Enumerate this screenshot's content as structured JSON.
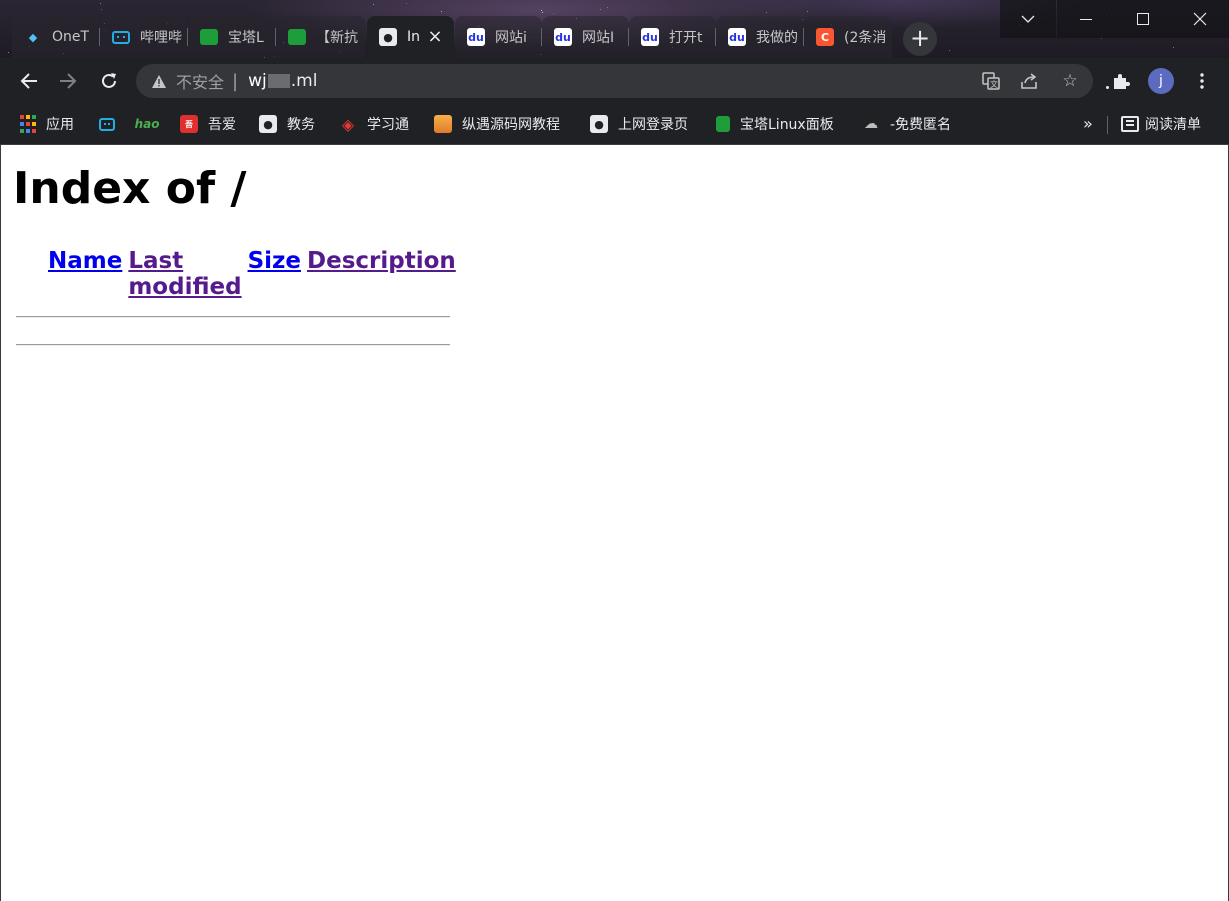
{
  "tabs": [
    {
      "title": "OneT",
      "favicon": "diamond-icon",
      "active": false
    },
    {
      "title": "哔哩哔",
      "favicon": "bilibili-icon",
      "active": false
    },
    {
      "title": "宝塔L",
      "favicon": "baota-icon",
      "active": false
    },
    {
      "title": "【新抗",
      "favicon": "baota-icon",
      "active": false
    },
    {
      "title": "In",
      "favicon": "globe-icon",
      "active": true
    },
    {
      "title": "网站i",
      "favicon": "baidu-icon",
      "active": false
    },
    {
      "title": "网站I",
      "favicon": "baidu-icon",
      "active": false
    },
    {
      "title": "打开t",
      "favicon": "baidu-icon",
      "active": false
    },
    {
      "title": "我做的",
      "favicon": "baidu-icon",
      "active": false
    },
    {
      "title": "(2条消",
      "favicon": "csdn-icon",
      "active": false
    }
  ],
  "toolbar": {
    "insecure_label": "不安全",
    "separator": "|",
    "url_prefix": "wj",
    "url_suffix": ".ml",
    "avatar_letter": "j"
  },
  "bookmarks": [
    {
      "label": "应用",
      "icon": "apps-grid-icon"
    },
    {
      "label": "",
      "icon": "bilibili-icon"
    },
    {
      "label": "",
      "icon": "hao123-icon"
    },
    {
      "label": "吾爱",
      "icon": "wuai-icon"
    },
    {
      "label": "教务",
      "icon": "globe-icon"
    },
    {
      "label": "学习通",
      "icon": "xuexitong-icon"
    },
    {
      "label": "纵遇源码网教程",
      "icon": "zongyu-icon"
    },
    {
      "label": "上网登录页",
      "icon": "globe-icon"
    },
    {
      "label": "宝塔Linux面板",
      "icon": "baota-icon"
    },
    {
      "label": "-免费匿名",
      "icon": "cloud-icon"
    }
  ],
  "bookmarks_more": "»",
  "reading_list_label": "阅读清单",
  "page": {
    "title": "Index of /",
    "columns": [
      {
        "label": "Name",
        "visited": false
      },
      {
        "label": "Last modified",
        "visited": true
      },
      {
        "label": "Size",
        "visited": false
      },
      {
        "label": "Description",
        "visited": true
      }
    ]
  },
  "colors": {
    "chrome_bg": "#202124",
    "link_unvisited": "#0000ee",
    "link_visited": "#551a8b",
    "csdn": "#fc5531",
    "baota_green": "#1e9e3a"
  }
}
